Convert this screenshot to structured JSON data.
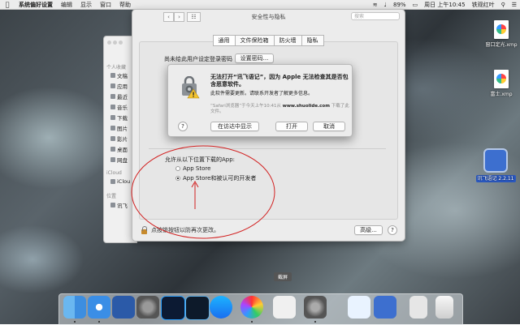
{
  "menubar": {
    "app": "系统偏好设置",
    "items": [
      "编辑",
      "显示",
      "窗口",
      "帮助"
    ],
    "battery": "89%",
    "clock": "周日 上午10:45",
    "user": "铁观红叶"
  },
  "finder": {
    "favorites_label": "个人收藏",
    "items": [
      "文稿",
      "应用",
      "最近",
      "音乐",
      "下载",
      "图片",
      "影片",
      "桌面",
      "网盘"
    ],
    "icloud_label": "iCloud",
    "icloud_item": "iClou",
    "locations_label": "位置",
    "locations_item": "讯飞"
  },
  "prefs": {
    "title": "安全性与隐私",
    "search_placeholder": "搜索",
    "tabs": [
      "通用",
      "文件保险箱",
      "防火墙",
      "隐私"
    ],
    "password_text": "尚未给此用户设定登录密码",
    "set_password_btn": "设置密码...",
    "allow_label": "允许从以下位置下载的App:",
    "options": [
      "App Store",
      "App Store和被认可的开发者"
    ],
    "lock_text": "点按锁按钮以防再次更改。",
    "advanced_btn": "高级...",
    "help": "?"
  },
  "alert": {
    "title": "无法打开“讯飞语记”，因为 Apple 无法检查其是否包含恶意软件。",
    "body": "此软件需要更新。请联系开发者了解更多信息。",
    "meta_prefix": "“Safari浏览器”于今天上午10:41从",
    "meta_domain": "www.shuolide.com",
    "meta_suffix": "下载了此文件。",
    "help": "?",
    "show_in_finder": "在访达中显示",
    "open": "打开",
    "cancel": "取消"
  },
  "desktop": {
    "icon1": "窗口定光.xmp",
    "icon2": "富士.xmp",
    "icon3": "讯飞语记 2.2.11"
  },
  "tooltip": "截屏",
  "colors": {
    "accent": "#2a58c0",
    "annotation": "#d22020"
  }
}
